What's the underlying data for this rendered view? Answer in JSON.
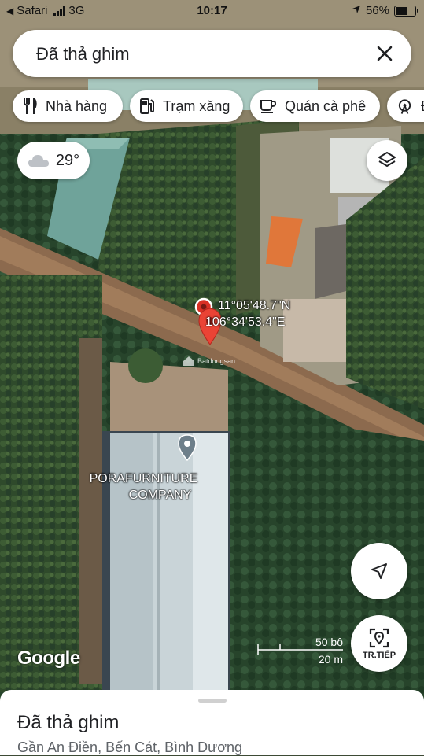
{
  "status_bar": {
    "back_app": "Safari",
    "carrier": "3G",
    "time": "10:17",
    "battery": "56%",
    "battery_level": 0.56
  },
  "search": {
    "value": "Đã thả ghim"
  },
  "chips": [
    {
      "icon": "restaurant-icon",
      "label": "Nhà hàng"
    },
    {
      "icon": "gas-station-icon",
      "label": "Trạm xăng"
    },
    {
      "icon": "coffee-icon",
      "label": "Quán cà phê"
    },
    {
      "icon": "attraction-icon",
      "label": "Đ"
    }
  ],
  "weather": {
    "icon": "cloud-icon",
    "temp": "29°"
  },
  "pin": {
    "lat": "11°05'48.7\"N",
    "lng": "106°34'53.4\"E"
  },
  "watermark": "Batdongsan",
  "poi": {
    "line1": "PORAFURNITURE",
    "line2": "COMPANY"
  },
  "google_logo": "Google",
  "scale": {
    "top": "50 bộ",
    "bottom": "20 m"
  },
  "buttons": {
    "next_label": "TR.TIẾP"
  },
  "bottom_sheet": {
    "title": "Đã thả ghim",
    "subtitle": "Gần An Điền, Bến Cát, Bình Dương"
  },
  "colors": {
    "pin": "#d93025",
    "accent": "#1a73e8"
  }
}
